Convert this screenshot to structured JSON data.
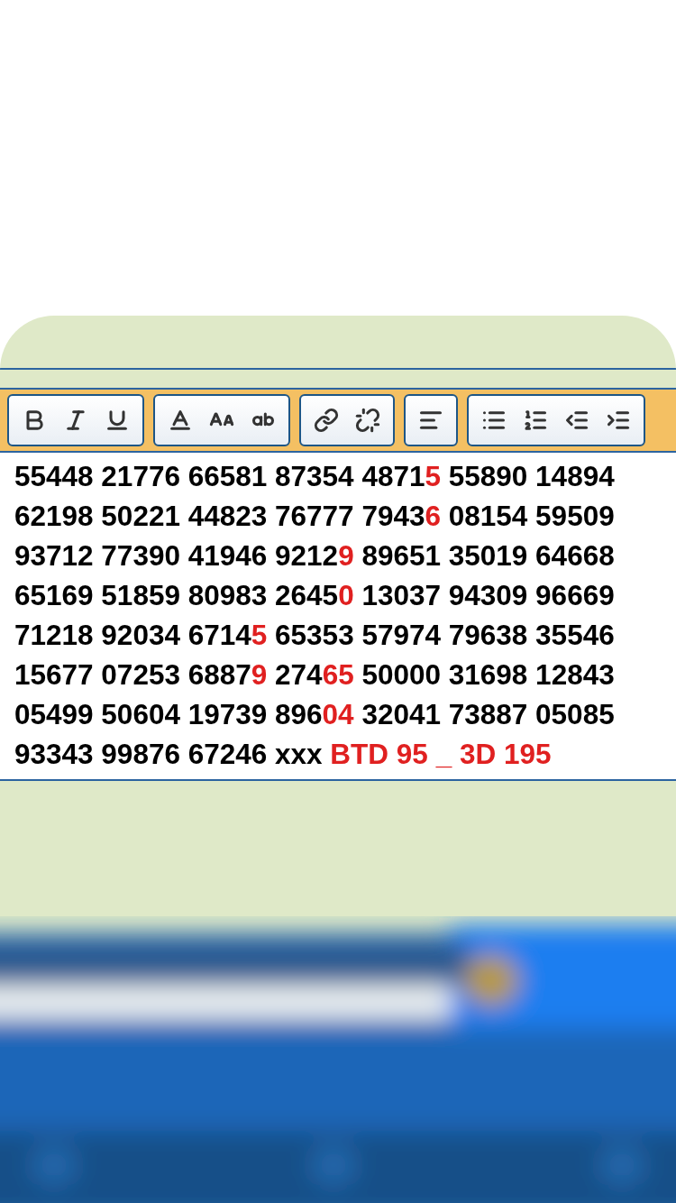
{
  "toolbar": {
    "groups": [
      {
        "tools": [
          {
            "kind": "bold"
          },
          {
            "kind": "italic"
          },
          {
            "kind": "underline"
          }
        ]
      },
      {
        "tools": [
          {
            "kind": "text-color"
          },
          {
            "kind": "font-size"
          },
          {
            "kind": "case"
          }
        ]
      },
      {
        "tools": [
          {
            "kind": "link"
          },
          {
            "kind": "unlink"
          }
        ]
      },
      {
        "tools": [
          {
            "kind": "align-left"
          }
        ]
      },
      {
        "tools": [
          {
            "kind": "bullet-list"
          },
          {
            "kind": "numbered-list"
          },
          {
            "kind": "outdent"
          },
          {
            "kind": "indent"
          }
        ]
      }
    ]
  },
  "editor": {
    "lines": [
      [
        {
          "text": "55448 21776 66581 87354 4871",
          "highlight": false
        },
        {
          "text": "5",
          "highlight": true
        },
        {
          "text": " 55890 14894",
          "highlight": false
        }
      ],
      [
        {
          "text": "62198 50221 44823 76777 7943",
          "highlight": false
        },
        {
          "text": "6",
          "highlight": true
        },
        {
          "text": " 08154 59509",
          "highlight": false
        }
      ],
      [
        {
          "text": "93712 77390 41946 9212",
          "highlight": false
        },
        {
          "text": "9",
          "highlight": true
        },
        {
          "text": " 89651 35019 64668",
          "highlight": false
        }
      ],
      [
        {
          "text": "65169 51859 80983 2645",
          "highlight": false
        },
        {
          "text": "0",
          "highlight": true
        },
        {
          "text": " 13037 94309 96669",
          "highlight": false
        }
      ],
      [
        {
          "text": "71218 92034 6714",
          "highlight": false
        },
        {
          "text": "5",
          "highlight": true
        },
        {
          "text": " 65353 57974 79638 35546",
          "highlight": false
        }
      ],
      [
        {
          "text": "15677 07253 6887",
          "highlight": false
        },
        {
          "text": "9",
          "highlight": true
        },
        {
          "text": " 274",
          "highlight": false
        },
        {
          "text": "65",
          "highlight": true
        },
        {
          "text": " 50000 31698 12843",
          "highlight": false
        }
      ],
      [
        {
          "text": "05499 50604 19739 896",
          "highlight": false
        },
        {
          "text": "04",
          "highlight": true
        },
        {
          "text": " 32041 73887 05085",
          "highlight": false
        }
      ],
      [
        {
          "text": "93343 99876 67246 xxx ",
          "highlight": false
        },
        {
          "text": "BTD 95 _ 3D 195",
          "highlight": true
        }
      ]
    ]
  }
}
